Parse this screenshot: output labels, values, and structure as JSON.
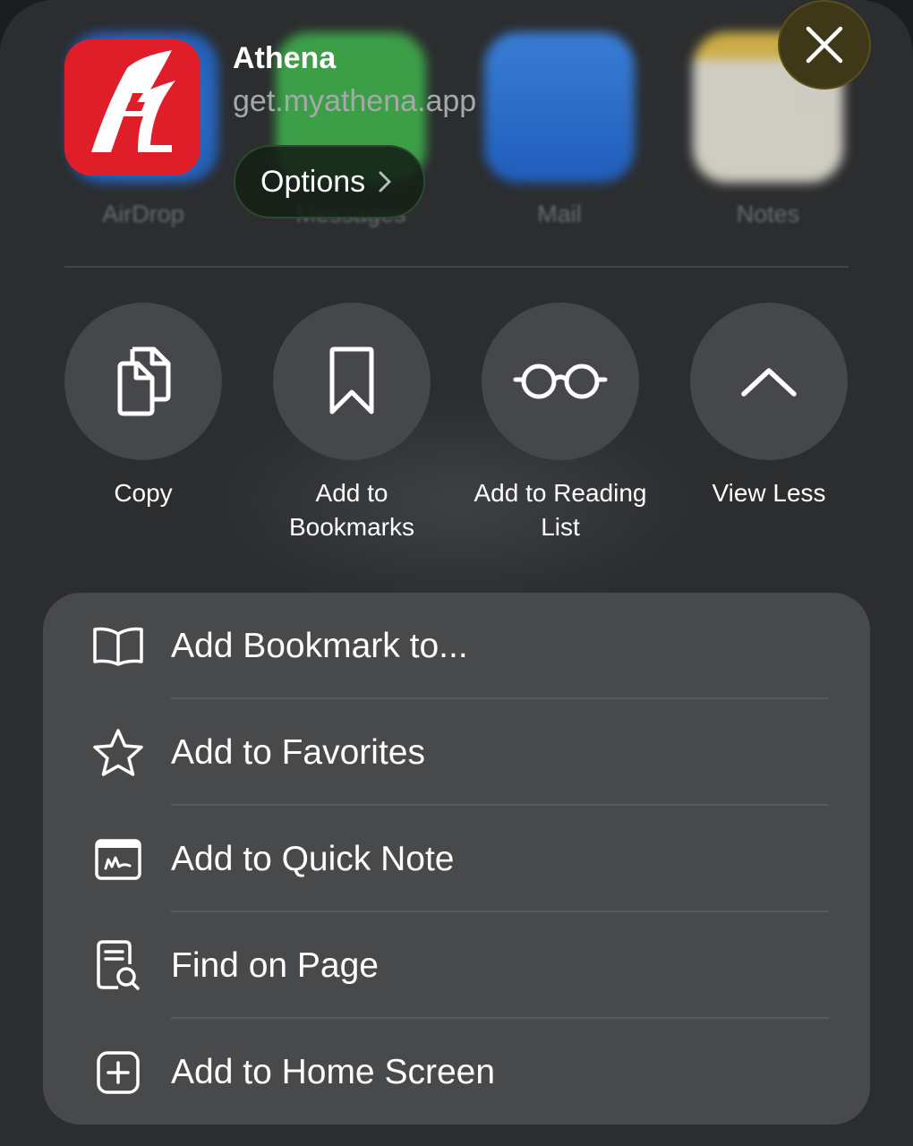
{
  "background_apps": [
    {
      "label": "AirDrop",
      "icon": "airdrop-icon"
    },
    {
      "label": "Messages",
      "icon": "messages-icon"
    },
    {
      "label": "Mail",
      "icon": "mail-icon"
    },
    {
      "label": "Notes",
      "icon": "notes-icon"
    }
  ],
  "header": {
    "app_name": "Athena",
    "url": "get.myathena.app",
    "options_label": "Options",
    "brand_color": "#e01e2a"
  },
  "actions": [
    {
      "label": "Copy",
      "icon": "copy-icon"
    },
    {
      "label": "Add to Bookmarks",
      "icon": "bookmark-icon"
    },
    {
      "label": "Add to Reading List",
      "icon": "glasses-icon"
    },
    {
      "label": "View Less",
      "icon": "chevron-up-icon"
    }
  ],
  "menu": [
    {
      "label": "Add Bookmark to...",
      "icon": "book-icon"
    },
    {
      "label": "Add to Favorites",
      "icon": "star-icon"
    },
    {
      "label": "Add to Quick Note",
      "icon": "quick-note-icon"
    },
    {
      "label": "Find on Page",
      "icon": "find-on-page-icon"
    },
    {
      "label": "Add to Home Screen",
      "icon": "plus-square-icon"
    }
  ]
}
